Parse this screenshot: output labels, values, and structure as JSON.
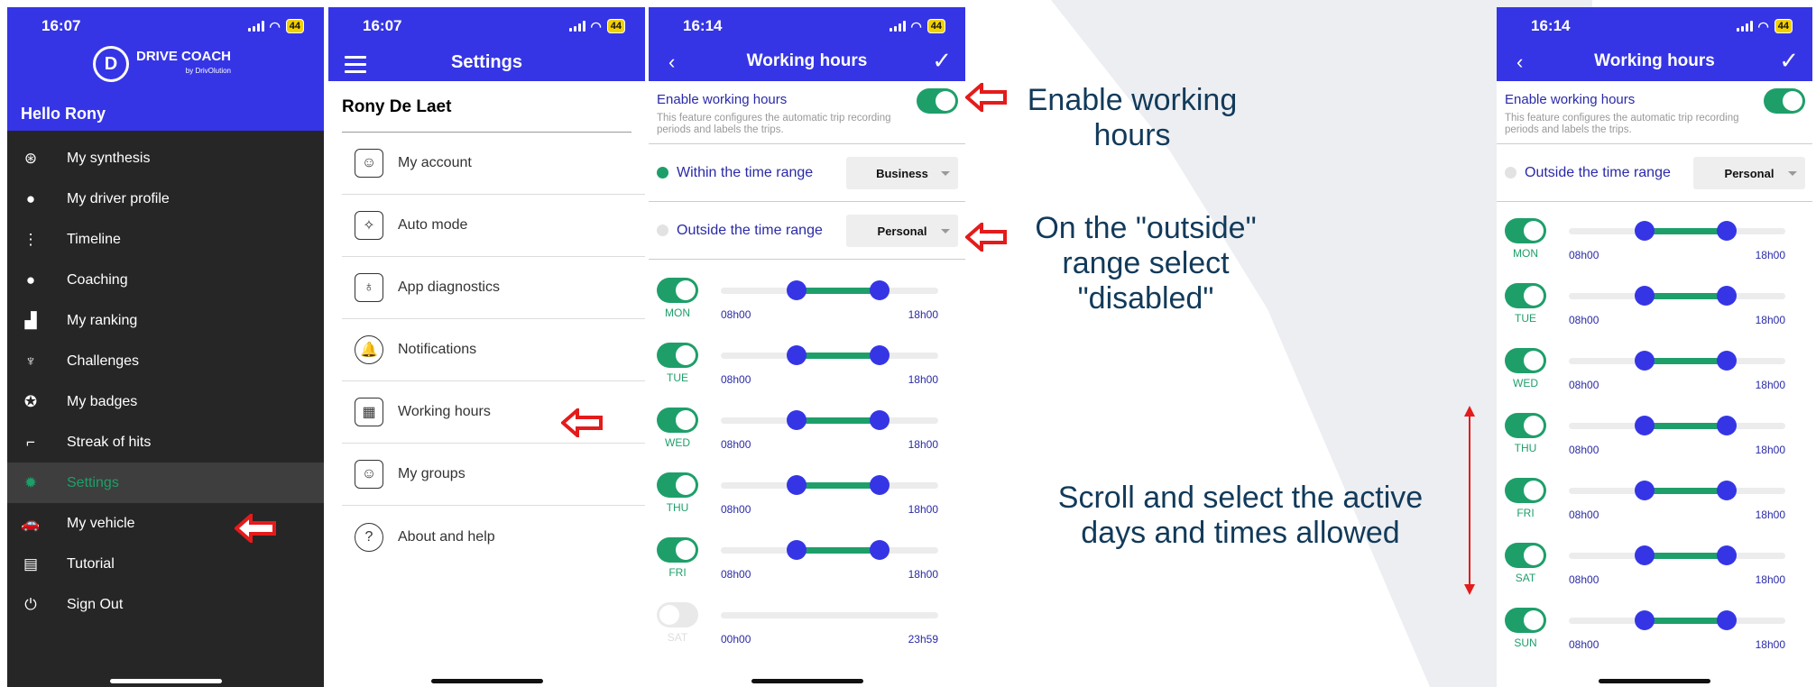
{
  "phone1": {
    "time": "16:07",
    "battery": "44",
    "logo": {
      "letter": "D",
      "name": "DRIVE COACH",
      "sub": "by DrivOlution"
    },
    "greeting": "Hello Rony",
    "menu": [
      {
        "label": "My synthesis",
        "icon": "steering-wheel-icon"
      },
      {
        "label": "My driver profile",
        "icon": "person-icon"
      },
      {
        "label": "Timeline",
        "icon": "timeline-icon"
      },
      {
        "label": "Coaching",
        "icon": "chat-bubble-icon"
      },
      {
        "label": "My ranking",
        "icon": "podium-icon"
      },
      {
        "label": "Challenges",
        "icon": "trophy-icon"
      },
      {
        "label": "My badges",
        "icon": "badge-icon"
      },
      {
        "label": "Streak of hits",
        "icon": "stairs-icon"
      },
      {
        "label": "Settings",
        "icon": "gear-icon"
      },
      {
        "label": "My vehicle",
        "icon": "car-icon"
      },
      {
        "label": "Tutorial",
        "icon": "presentation-icon"
      },
      {
        "label": "Sign Out",
        "icon": "sign-out-icon"
      }
    ]
  },
  "phone2": {
    "time": "16:07",
    "battery": "44",
    "title": "Settings",
    "user": "Rony De Laet",
    "items": [
      {
        "label": "My account",
        "icon": "account-icon"
      },
      {
        "label": "Auto mode",
        "icon": "magic-wand-icon"
      },
      {
        "label": "App diagnostics",
        "icon": "stethoscope-icon"
      },
      {
        "label": "Notifications",
        "icon": "bell-icon"
      },
      {
        "label": "Working hours",
        "icon": "calendar-clock-icon"
      },
      {
        "label": "My groups",
        "icon": "group-icon"
      },
      {
        "label": "About and help",
        "icon": "help-icon"
      }
    ]
  },
  "phone3": {
    "time": "16:14",
    "battery": "44",
    "title": "Working hours",
    "enable_label": "Enable working hours",
    "enable_desc": "This feature configures the automatic trip recording periods and labels the trips.",
    "within_label": "Within the time range",
    "within_value": "Business",
    "outside_label": "Outside the time range",
    "outside_value": "Personal",
    "days": [
      {
        "name": "MON",
        "on": true,
        "start": "08h00",
        "end": "18h00",
        "start_frac": 0.35,
        "end_frac": 0.73
      },
      {
        "name": "TUE",
        "on": true,
        "start": "08h00",
        "end": "18h00",
        "start_frac": 0.35,
        "end_frac": 0.73
      },
      {
        "name": "WED",
        "on": true,
        "start": "08h00",
        "end": "18h00",
        "start_frac": 0.35,
        "end_frac": 0.73
      },
      {
        "name": "THU",
        "on": true,
        "start": "08h00",
        "end": "18h00",
        "start_frac": 0.35,
        "end_frac": 0.73
      },
      {
        "name": "FRI",
        "on": true,
        "start": "08h00",
        "end": "18h00",
        "start_frac": 0.35,
        "end_frac": 0.73
      },
      {
        "name": "SAT",
        "on": false,
        "start": "00h00",
        "end": "23h59",
        "start_frac": 0,
        "end_frac": 1
      }
    ]
  },
  "phone4": {
    "time": "16:14",
    "battery": "44",
    "title": "Working hours",
    "enable_label": "Enable working hours",
    "enable_desc": "This feature configures the automatic trip recording periods and labels the trips.",
    "outside_label": "Outside the time range",
    "outside_value": "Personal",
    "days": [
      {
        "name": "MON",
        "on": true,
        "start": "08h00",
        "end": "18h00",
        "start_frac": 0.35,
        "end_frac": 0.73
      },
      {
        "name": "TUE",
        "on": true,
        "start": "08h00",
        "end": "18h00",
        "start_frac": 0.35,
        "end_frac": 0.73
      },
      {
        "name": "WED",
        "on": true,
        "start": "08h00",
        "end": "18h00",
        "start_frac": 0.35,
        "end_frac": 0.73
      },
      {
        "name": "THU",
        "on": true,
        "start": "08h00",
        "end": "18h00",
        "start_frac": 0.35,
        "end_frac": 0.73
      },
      {
        "name": "FRI",
        "on": true,
        "start": "08h00",
        "end": "18h00",
        "start_frac": 0.35,
        "end_frac": 0.73
      },
      {
        "name": "SAT",
        "on": true,
        "start": "08h00",
        "end": "18h00",
        "start_frac": 0.35,
        "end_frac": 0.73
      },
      {
        "name": "SUN",
        "on": true,
        "start": "08h00",
        "end": "18h00",
        "start_frac": 0.35,
        "end_frac": 0.73
      }
    ]
  },
  "annotations": {
    "enable": [
      "Enable working",
      "hours"
    ],
    "outside": [
      "On the \"outside\"",
      "range select",
      "\"disabled\""
    ],
    "scroll": [
      "Scroll and select the active",
      "days and times allowed"
    ]
  },
  "colors": {
    "brand": "#3535e6",
    "accent": "#1e9f6a",
    "arrow": "#e41b1b",
    "annotation": "#123a5a"
  }
}
